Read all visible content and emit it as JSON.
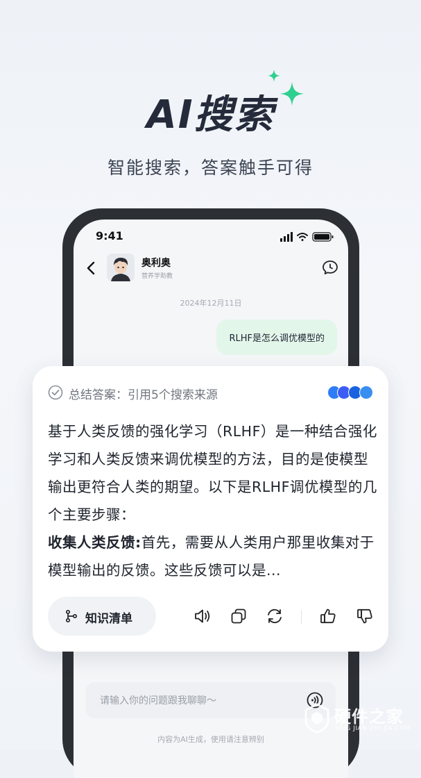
{
  "hero": {
    "title": "AI搜索",
    "subtitle": "智能搜索，答案触手可得"
  },
  "status_bar": {
    "time": "9:41"
  },
  "chat": {
    "contact_name": "奥利奥",
    "contact_role": "营养学助教",
    "date": "2024年12月11日",
    "user_message": "RLHF是怎么调优模型的",
    "input_placeholder": "请输入你的问题跟我聊聊～",
    "disclaimer": "内容为AI生成，使用请注意辨别"
  },
  "answer_card": {
    "summary_label": "总结答案：引用5个搜索来源",
    "sources": [
      {
        "icon": "source-blue-logo",
        "color": "#2f7df6"
      },
      {
        "icon": "source-baidu-logo",
        "color": "#3d5cf5"
      },
      {
        "icon": "source-zhihu-logo",
        "color": "#1a63e0"
      },
      {
        "icon": "source-c-logo",
        "color": "#3a8ef0"
      }
    ],
    "para_1": "基于人类反馈的强化学习（RLHF）是一种结合强化学习和人类反馈来调优模型的方法，目的是使模型输出更符合人类的期望。以下是RLHF调优模型的几个主要步骤：",
    "bold_lead": "收集人类反馈:",
    "para_2": "首先，需要从人类用户那里收集对于模型输出的反馈。这些反馈可以是...",
    "knowledge_button": "知识清单"
  },
  "watermark": {
    "title": "硬件之家",
    "subtitle": "YING JIAN ZHI JIA.COM"
  },
  "colors": {
    "accent_green": "#2fcf8f",
    "user_bubble": "#e3f6ea",
    "phone_frame": "#2c2f34"
  }
}
